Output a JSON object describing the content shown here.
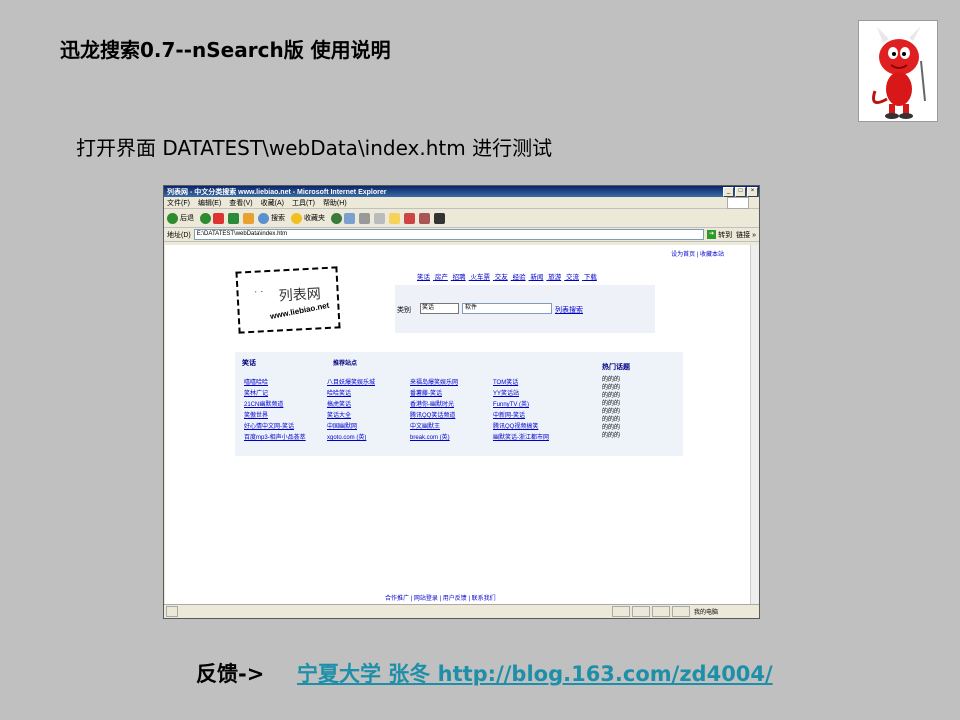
{
  "slide": {
    "title": "迅龙搜索0.7--nSearch版  使用说明",
    "subtitle": "打开界面  DATATEST\\webData\\index.htm  进行测试",
    "footer_label": "反馈->",
    "footer_link": "宁夏大学 张冬  http://blog.163.com/zd4004/"
  },
  "browser": {
    "window_title": "列表网 - 中文分类搜索 www.liebiao.net - Microsoft Internet Explorer",
    "menu": [
      "文件(F)",
      "编辑(E)",
      "查看(V)",
      "收藏(A)",
      "工具(T)",
      "帮助(H)"
    ],
    "toolbar": {
      "back": "后退",
      "search": "搜索",
      "favorites": "收藏夹"
    },
    "address_label": "地址(D)",
    "address_value": "E:\\DATATEST\\webData\\index.htm",
    "go_label": "转到",
    "links_label": "链接 »",
    "status_text": "我的电脑"
  },
  "page": {
    "top_links": "设为首页 | 收藏本站",
    "logo_text": "列表网",
    "logo_url": "www.liebiao.net",
    "category_nav": [
      "笑话",
      "房产",
      "招聘",
      "火车票",
      "交友",
      "经验",
      "新闻",
      "旅游",
      "交流",
      "下载"
    ],
    "search": {
      "label": "类别",
      "category": "笑话",
      "query": "软件",
      "button": "列表搜索"
    },
    "section_heading": "笑话",
    "recommend_heading": "推荐站点",
    "hot_heading": "热门话题",
    "links_col1": [
      "嘻嘻哈哈",
      "笑林广记",
      "21CN幽默频道",
      "笑傲世界",
      "好心情中文网-笑话",
      "百度mp3-相声小品荟萃"
    ],
    "links_col2": [
      "八目妖爆笑娱乐城",
      "哈哈笑话",
      "搞虎笑话",
      "笑话大全",
      "中国幽默网",
      "xgoto.com (英)"
    ],
    "links_col3": [
      "来福岛爆笑娱乐网",
      "番薯藤-笑话",
      "香港你-幽默时光",
      "腾讯QQ笑话频道",
      "中文幽默王",
      "break.com (英)"
    ],
    "links_col4": [
      "TOM笑话",
      "YY笑话站",
      "FunnyTV (英)",
      "中新网-笑话",
      "腾讯QQ视频搞笑",
      "幽默笑话-浙江都市网"
    ],
    "hot_topics": [
      "的的的",
      "的的的",
      "的的的",
      "的的的",
      "的的的",
      "的的的",
      "的的的",
      "的的的"
    ],
    "bottom_links": "合作推广 | 网站登录 | 用户反馈 | 联系我们"
  },
  "colors": {
    "background": "#c0c0c0",
    "footer_link": "#1e8fa8",
    "link": "#0000cc"
  }
}
